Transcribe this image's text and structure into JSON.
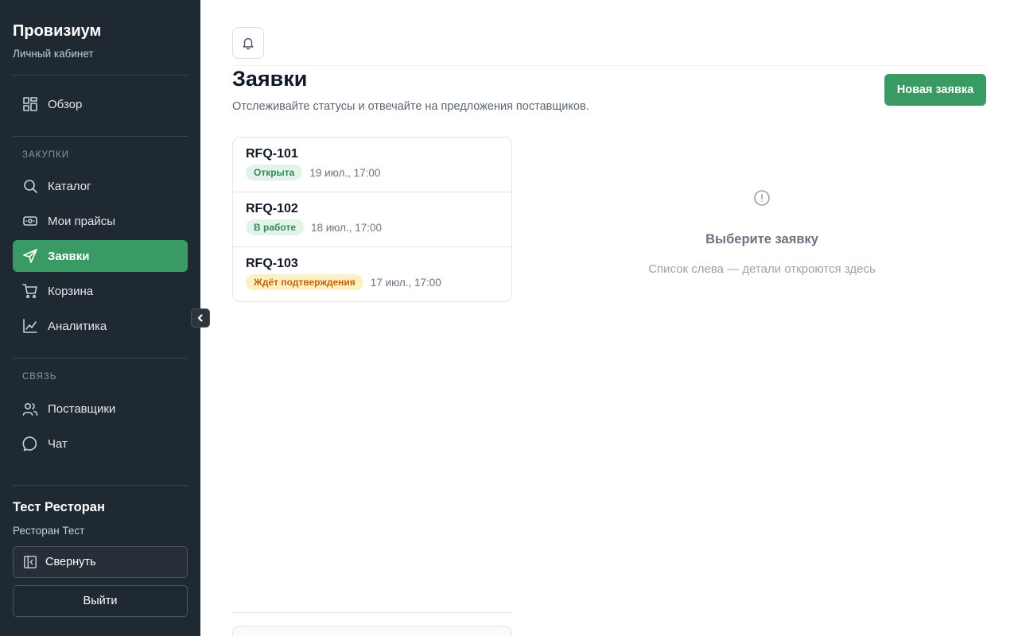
{
  "sidebar": {
    "brand_title": "Провизиум",
    "brand_subtitle": "Личный кабинет",
    "overview": {
      "label": "Обзор",
      "icon": "dashboard-icon"
    },
    "sections": [
      {
        "label": "ЗАКУПКИ",
        "items": [
          {
            "label": "Каталог",
            "icon": "search-icon",
            "active": false
          },
          {
            "label": "Мои прайсы",
            "icon": "price-list-icon",
            "active": false
          },
          {
            "label": "Заявки",
            "icon": "send-icon",
            "active": true
          },
          {
            "label": "Корзина",
            "icon": "cart-icon",
            "active": false
          },
          {
            "label": "Аналитика",
            "icon": "chart-icon",
            "active": false
          }
        ]
      },
      {
        "label": "СВЯЗЬ",
        "items": [
          {
            "label": "Поставщики",
            "icon": "users-icon",
            "active": false
          },
          {
            "label": "Чат",
            "icon": "chat-icon",
            "active": false
          }
        ]
      }
    ],
    "org_title": "Тест Ресторан",
    "org_subtitle": "Ресторан Тест",
    "collapse_label": "Свернуть",
    "logout_label": "Выйти"
  },
  "header": {
    "title": "Заявки",
    "description": "Отслеживайте статусы и отвечайте на предложения поставщиков.",
    "new_button_label": "Новая заявка"
  },
  "rfq_list": [
    {
      "id": "RFQ-101",
      "status": "Открыта",
      "status_tone": "green",
      "date": "19 июл., 17:00"
    },
    {
      "id": "RFQ-102",
      "status": "В работе",
      "status_tone": "green",
      "date": "18 июл., 17:00"
    },
    {
      "id": "RFQ-103",
      "status": "Ждёт подтверждения",
      "status_tone": "amber",
      "date": "17 июл., 17:00"
    }
  ],
  "empty_state": {
    "title": "Выберите заявку",
    "subtitle": "Список слева — детали откроются здесь",
    "icon": "alert-circle-icon"
  },
  "colors": {
    "sidebar_bg": "#1f2932",
    "accent": "#3a9a64",
    "badge_green_bg": "#e4f3ea",
    "badge_amber_bg": "#fdf0c4"
  }
}
